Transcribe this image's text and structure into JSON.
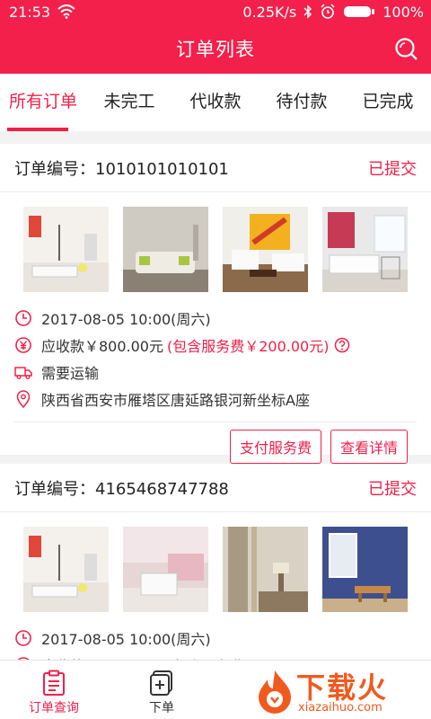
{
  "status_bar": {
    "time": "21:53",
    "speed": "0.25K/s",
    "battery": "100%"
  },
  "header": {
    "title": "订单列表"
  },
  "tabs": [
    "所有订单",
    "未完工",
    "代收款",
    "待付款",
    "已完成"
  ],
  "orders": [
    {
      "number": "订单编号：1010101010101",
      "status": "已提交",
      "datetime": "2017-08-05  10:00(周六)",
      "receivable": "应收款￥800.00元",
      "service_fee": "(包含服务费￥200.00元)",
      "transport": "需要运输",
      "address": "陕西省西安市雁塔区唐延路银河新坐标A座",
      "btn_pay": "支付服务费",
      "btn_detail": "查看详情"
    },
    {
      "number": "订单编号：4165468747788",
      "status": "已提交",
      "datetime": "2017-08-05  10:00(周六)",
      "receivable": "应收款￥768.00元",
      "service_fee": "(包含服务费￥120.00元)"
    }
  ],
  "bottom_nav": [
    "订单查询",
    "下单"
  ],
  "watermark": {
    "text": "下载火",
    "url": "xiazaihuo.com"
  },
  "colors": {
    "brand": "#f2204a"
  }
}
